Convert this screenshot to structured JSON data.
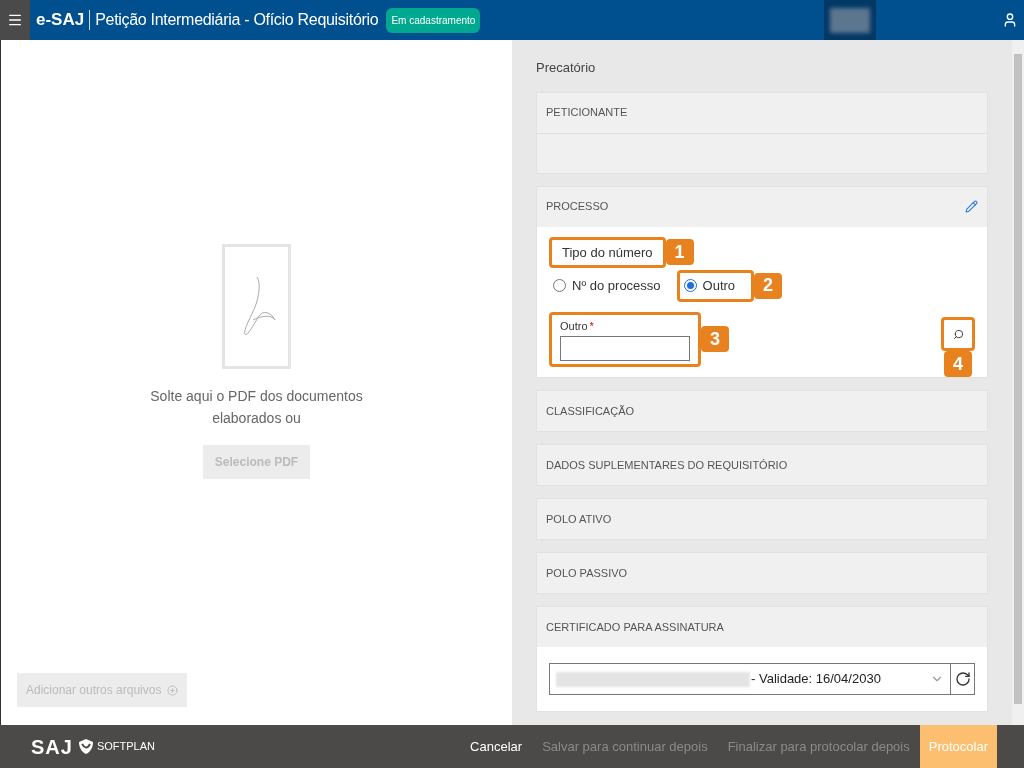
{
  "header": {
    "app_name": "e-SAJ",
    "title": "Petição Intermediária - Ofício Requisitório",
    "status_badge": "Em cadastramento"
  },
  "left_panel": {
    "drop_text": "Solte aqui o PDF dos documentos elaborados ou",
    "select_button": {
      "label": "Selecione PDF",
      "disabled": true
    },
    "add_files_button": {
      "label": "Adicionar outros arquivos",
      "disabled": true
    }
  },
  "right_panel": {
    "heading": "Precatório",
    "sections": [
      {
        "kind": "empty",
        "title": "PETICIONANTE"
      },
      {
        "kind": "processo",
        "title": "PROCESSO",
        "type_label": "Tipo do número",
        "type_label_callout": "1",
        "radios": [
          {
            "label": "Nº do processo",
            "selected": false
          },
          {
            "label": "Outro",
            "selected": true,
            "callout": "2"
          }
        ],
        "field": {
          "label": "Outro",
          "required_mark": "*",
          "callout": "3"
        },
        "search_callout": "4"
      },
      {
        "kind": "collapsed",
        "title": "CLASSIFICAÇÃO"
      },
      {
        "kind": "collapsed",
        "title": "DADOS SUPLEMENTARES DO REQUISITÓRIO"
      },
      {
        "kind": "collapsed",
        "title": "POLO ATIVO"
      },
      {
        "kind": "collapsed",
        "title": "POLO PASSIVO"
      },
      {
        "kind": "certificate",
        "title": "CERTIFICADO PARA ASSINATURA",
        "value": "- Validade: 16/04/2030"
      }
    ]
  },
  "footer": {
    "logo": "SAJ",
    "brand": "SOFTPLAN",
    "buttons": [
      {
        "label": "Cancelar",
        "kind": "link"
      },
      {
        "label": "Salvar para continuar depois",
        "kind": "disabled"
      },
      {
        "label": "Finalizar para protocolar depois",
        "kind": "disabled"
      },
      {
        "label": "Protocolar",
        "kind": "primary"
      }
    ]
  }
}
